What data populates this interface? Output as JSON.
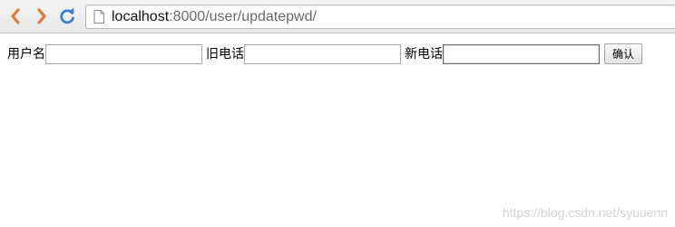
{
  "browser": {
    "url_host": "localhost",
    "url_rest": ":8000/user/updatepwd/"
  },
  "form": {
    "username_label": "用户名",
    "old_phone_label": "旧电话",
    "new_phone_label": "新电话",
    "username_value": "",
    "old_phone_value": "",
    "new_phone_value": "",
    "confirm_label": "确认"
  },
  "watermark": "https://blog.csdn.net/syuuenn",
  "colors": {
    "back_arrow": "#e07a3a",
    "forward_arrow": "#e07a3a",
    "reload": "#3c7fd1"
  },
  "icons": {
    "back": "chevron-left",
    "forward": "chevron-right",
    "reload": "circular-arrow",
    "page": "document"
  }
}
